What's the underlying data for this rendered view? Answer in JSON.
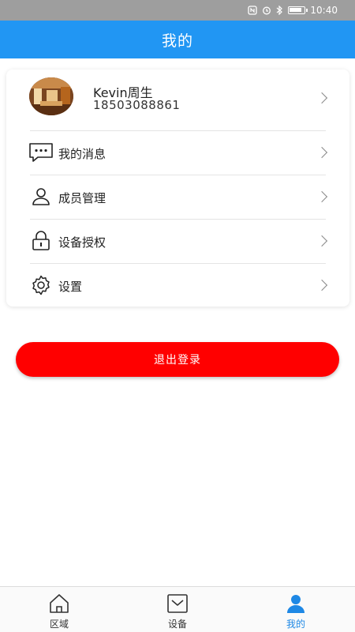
{
  "status_bar": {
    "time": "10:40",
    "icons": [
      "nfc-icon",
      "alarm-icon",
      "bluetooth-icon",
      "battery-icon"
    ]
  },
  "header": {
    "title": "我的"
  },
  "profile": {
    "name": "Kevin周生",
    "phone": "18503088861"
  },
  "menu": [
    {
      "label": "我的消息",
      "icon": "message-icon"
    },
    {
      "label": "成员管理",
      "icon": "user-icon"
    },
    {
      "label": "设备授权",
      "icon": "lock-icon"
    },
    {
      "label": "设置",
      "icon": "gear-icon"
    }
  ],
  "logout": {
    "label": "退出登录",
    "color": "#ff0000"
  },
  "tabs": [
    {
      "label": "区域",
      "icon": "home-icon",
      "active": false
    },
    {
      "label": "设备",
      "icon": "device-icon",
      "active": false
    },
    {
      "label": "我的",
      "icon": "person-icon",
      "active": true
    }
  ],
  "colors": {
    "header": "#2196f3",
    "accent": "#1e88e5",
    "danger": "#ff0000"
  }
}
